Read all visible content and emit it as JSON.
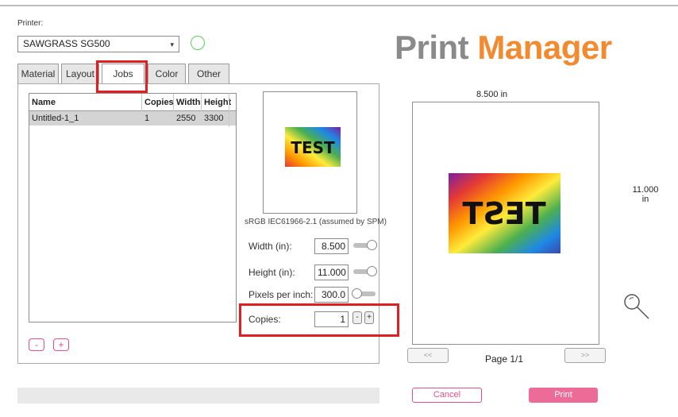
{
  "printer": {
    "label": "Printer:",
    "selected": "SAWGRASS SG500",
    "dropdown_caret": "▾",
    "status_color": "#5bd05b"
  },
  "logo": {
    "part1": "Print",
    "part2": "Manager",
    "color1": "#8a8a8a",
    "color2": "#f28a30"
  },
  "tabs": [
    {
      "label": "Material",
      "active": false
    },
    {
      "label": "Layout",
      "active": false
    },
    {
      "label": "Jobs",
      "active": true
    },
    {
      "label": "Color",
      "active": false
    },
    {
      "label": "Other",
      "active": false
    }
  ],
  "jobs_table": {
    "columns": [
      "Name",
      "Copies",
      "Width",
      "Height"
    ],
    "rows": [
      {
        "name": "Untitled-1_1",
        "copies": "1",
        "width": "2550",
        "height": "3300",
        "selected": true
      }
    ]
  },
  "job_buttons": {
    "remove": "-",
    "add": "+"
  },
  "thumbnail": {
    "text": "TEST"
  },
  "color_profile": "sRGB IEC61966-2.1 (assumed by SPM)",
  "settings": {
    "width": {
      "label": "Width (in):",
      "value": "8.500",
      "toggle_on": true
    },
    "height": {
      "label": "Height (in):",
      "value": "11.000",
      "toggle_on": true
    },
    "ppi": {
      "label": "Pixels per inch:",
      "value": "300.0",
      "toggle_on": false
    },
    "copies": {
      "label": "Copies:",
      "value": "1",
      "minus": "-",
      "plus": "+"
    }
  },
  "page_preview": {
    "width_label": "8.500 in",
    "height_value": "11.000",
    "height_unit": "in",
    "image_text": "TEST",
    "page_label": "Page 1/1",
    "prev": "<<",
    "next": ">>"
  },
  "actions": {
    "cancel": "Cancel",
    "print": "Print"
  },
  "accent_color": "#e0508a",
  "highlight_color": "#e02020",
  "icons": {
    "zoom": "magnifier-icon"
  }
}
